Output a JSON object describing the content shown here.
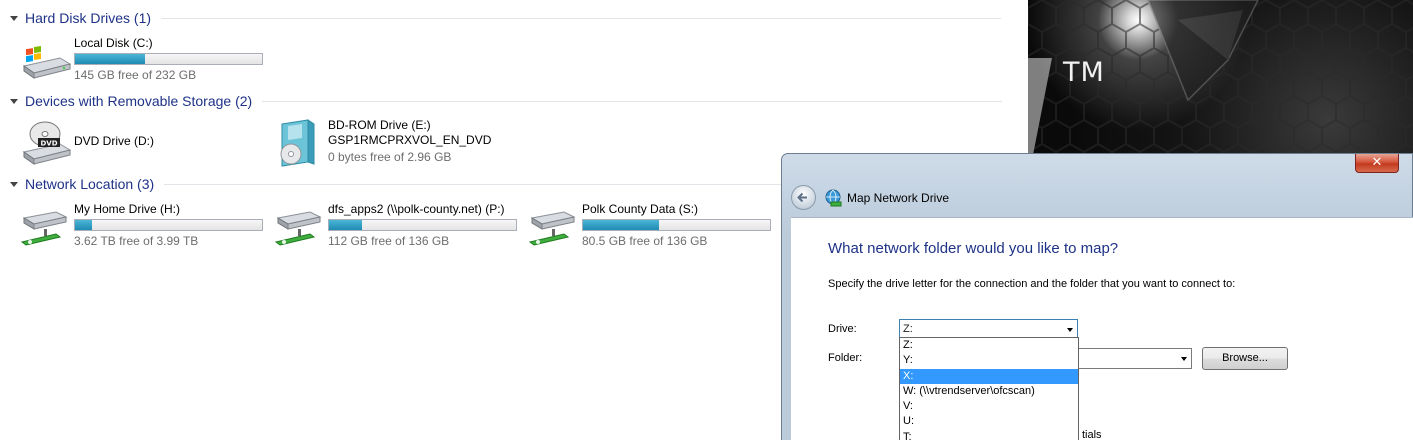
{
  "explorer": {
    "groups": [
      {
        "title": "Hard Disk Drives (1)",
        "drives": [
          {
            "name": "Local Disk (C:)",
            "free_text": "145 GB free of 232 GB",
            "used_fraction": 0.375,
            "icon": "windows-hard-disk-icon"
          }
        ]
      },
      {
        "title": "Devices with Removable Storage (2)",
        "drives": [
          {
            "name": "DVD Drive (D:)",
            "icon": "dvd-drive-icon"
          },
          {
            "name": "BD-ROM Drive (E:)",
            "label": "GSP1RMCPRXVOL_EN_DVD",
            "free_text": "0 bytes free of 2.96 GB",
            "icon": "bd-rom-disc-icon"
          }
        ]
      },
      {
        "title": "Network Location (3)",
        "drives": [
          {
            "name": "My Home Drive (H:)",
            "free_text": "3.62 TB free of 3.99 TB",
            "used_fraction": 0.093,
            "icon": "network-drive-icon"
          },
          {
            "name": "dfs_apps2 (\\\\polk-county.net) (P:)",
            "free_text": "112 GB free of 136 GB",
            "used_fraction": 0.176,
            "icon": "network-drive-icon"
          },
          {
            "name": "Polk County Data (S:)",
            "free_text": "80.5 GB free of 136 GB",
            "used_fraction": 0.408,
            "icon": "network-drive-icon"
          }
        ]
      }
    ]
  },
  "wallpaper": {
    "trademark": "TM"
  },
  "dialog": {
    "title": "Map Network Drive",
    "close_glyph": "✕",
    "heading": "What network folder would you like to map?",
    "instruction": "Specify the drive letter for the connection and the folder that you want to connect to:",
    "drive_label": "Drive:",
    "drive_value": "Z:",
    "folder_label": "Folder:",
    "folder_value": "",
    "browse_label": "Browse...",
    "partial_text": "tials"
  },
  "drive_options": [
    {
      "label": "Z:",
      "selected": false
    },
    {
      "label": "Y:",
      "selected": false
    },
    {
      "label": "X:",
      "selected": true
    },
    {
      "label": "W: (\\\\vtrendserver\\ofcscan)",
      "selected": false
    },
    {
      "label": "V:",
      "selected": false
    },
    {
      "label": "U:",
      "selected": false
    },
    {
      "label": "T:",
      "selected": false
    }
  ],
  "colors": {
    "group_title": "#1e3287",
    "bar_fill": "#26a0da",
    "selection": "#3399ff"
  }
}
